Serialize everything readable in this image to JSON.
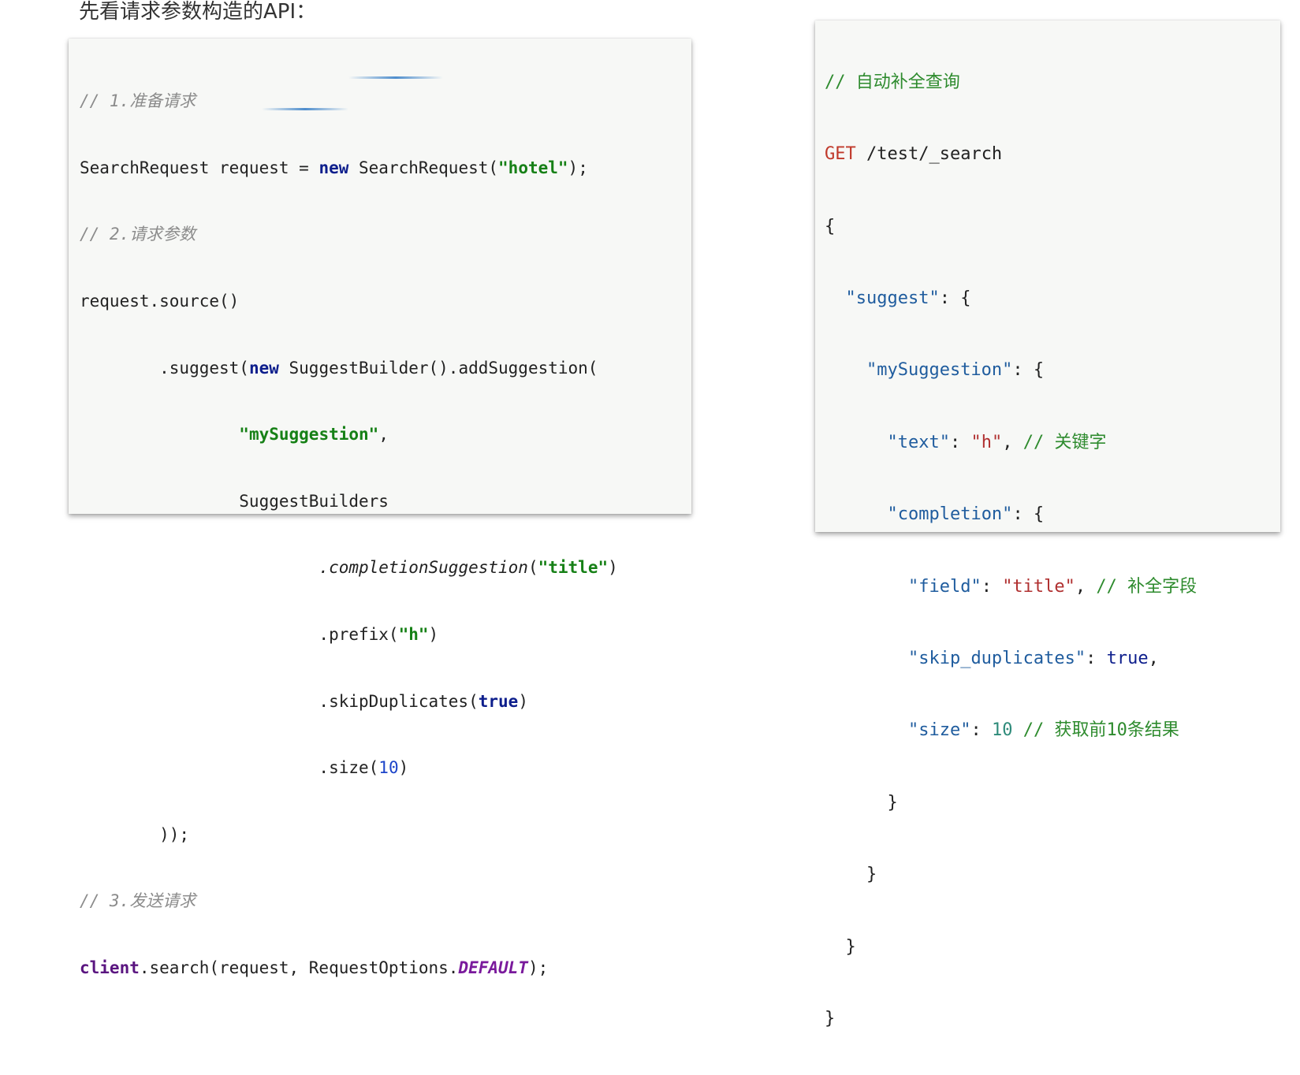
{
  "heading": "先看请求参数构造的API：",
  "java": {
    "c1": "// 1.准备请求",
    "l2a": "SearchRequest request = ",
    "l2kw": "new",
    "l2b": " SearchRequest(",
    "l2str": "\"hotel\"",
    "l2c": ");",
    "c3": "// 2.请求参数",
    "l4": "request.source()",
    "l5a": "        .suggest(",
    "l5kw": "new",
    "l5b": " SuggestBuilder().addSuggestion(",
    "l6ind": "                ",
    "l6str": "\"mySuggestion\"",
    "l6c": ",",
    "l7": "                SuggestBuilders",
    "l8ind": "                        ",
    "l8it": ".completionSuggestion",
    "l8b": "(",
    "l8str": "\"title\"",
    "l8c": ")",
    "l9a": "                        .prefix(",
    "l9str": "\"h\"",
    "l9c": ")",
    "l10a": "                        .skipDuplicates(",
    "l10kw": "true",
    "l10c": ")",
    "l11a": "                        .size(",
    "l11num": "10",
    "l11c": ")",
    "l12": "        ));",
    "c13": "// 3.发送请求",
    "l14var": "client",
    "l14a": ".search(request, RequestOptions.",
    "l14const": "DEFAULT",
    "l14c": ");"
  },
  "dsl": {
    "c1": "// 自动补全查询",
    "get": "GET",
    "path": " /test/_search",
    "open": "{",
    "suggest_ind": "  ",
    "suggest_key": "\"suggest\"",
    "suggest_rest": ": {",
    "my_ind": "    ",
    "my_key": "\"mySuggestion\"",
    "my_rest": ": {",
    "text_ind": "      ",
    "text_key": "\"text\"",
    "text_colon": ": ",
    "text_val": "\"h\"",
    "text_comma": ", ",
    "text_cmt": "// 关键字",
    "comp_ind": "      ",
    "comp_key": "\"completion\"",
    "comp_rest": ": {",
    "field_ind": "        ",
    "field_key": "\"field\"",
    "field_colon": ": ",
    "field_val": "\"title\"",
    "field_comma": ", ",
    "field_cmt": "// 补全字段",
    "skip_ind": "        ",
    "skip_key": "\"skip_duplicates\"",
    "skip_colon": ": ",
    "skip_val": "true",
    "skip_comma": ",",
    "size_ind": "        ",
    "size_key": "\"size\"",
    "size_colon": ": ",
    "size_val": "10",
    "size_sp": " ",
    "size_cmt": "// 获取前10条结果",
    "close1": "      }",
    "close2": "    }",
    "close3": "  }",
    "close4": "}"
  }
}
